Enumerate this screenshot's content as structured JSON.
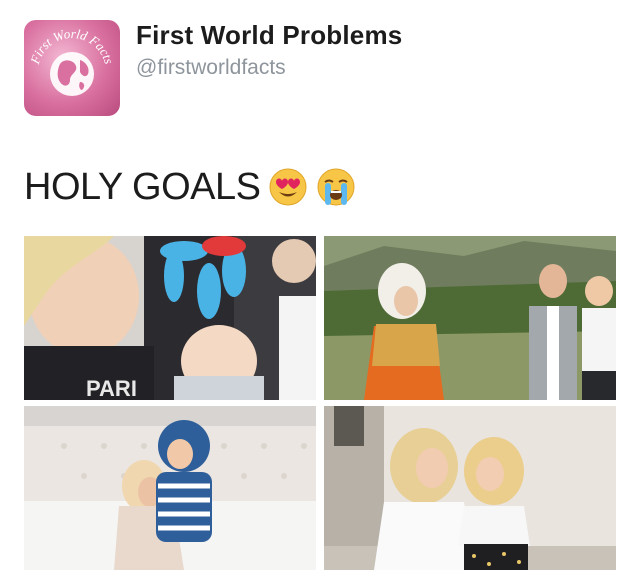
{
  "account": {
    "display_name": "First World Problems",
    "handle": "@firstworldfacts",
    "avatar_text": "First World Facts",
    "avatar_icon": "globe-icon"
  },
  "tweet": {
    "text": "HOLY GOALS",
    "emojis": [
      "heart-eyes-emoji",
      "loudly-crying-emoji"
    ]
  },
  "media": {
    "photos": [
      {
        "description_icon": "photo-mom-baby-balloon",
        "shirt_text": "PARI"
      },
      {
        "description_icon": "photo-family-field"
      },
      {
        "description_icon": "photo-mom-toddler-bed"
      },
      {
        "description_icon": "photo-mom-daughter-outdoor"
      }
    ]
  },
  "colors": {
    "name": "#1c1c1c",
    "handle": "#8e959c",
    "avatar_pink": "#d9709f"
  }
}
